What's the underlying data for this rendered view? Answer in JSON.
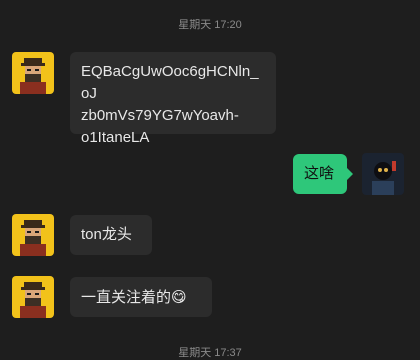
{
  "timestamps": [
    "星期天 17:20",
    "星期天 17:37"
  ],
  "messages": [
    {
      "from": "contact",
      "text": "EQBaCgUwOoc6gHCNln_oJ\nzb0mVs79YG7wYoavh-\no1ItaneLA"
    },
    {
      "from": "me",
      "text": "这啥"
    },
    {
      "from": "contact",
      "text": "ton龙头"
    },
    {
      "from": "contact",
      "text": "一直关注着的",
      "emoji": "😋"
    }
  ],
  "colors": {
    "background": "#1e1e1e",
    "incoming_bubble": "#2c2c2c",
    "outgoing_bubble": "#2ec77a",
    "timestamp": "#8a8a8a",
    "avatar_contact_bg": "#f2c21a"
  }
}
